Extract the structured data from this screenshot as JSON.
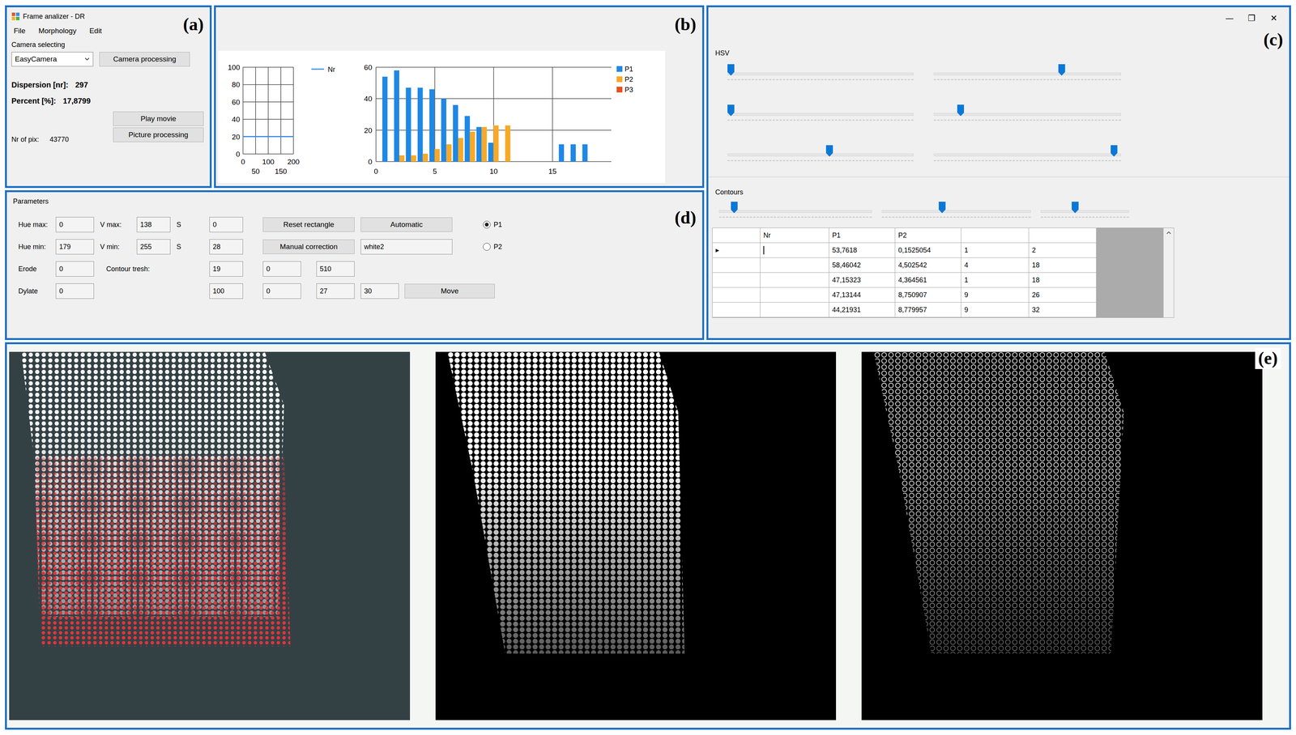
{
  "main_window": {
    "panel_label": "(a)",
    "title": "Frame analizer - DR",
    "menu": [
      "File",
      "Morphology",
      "Edit"
    ],
    "camera_group": "Camera selecting",
    "camera_dropdown": "EasyCamera",
    "camera_button": "Camera processing",
    "stats": [
      {
        "label": "Dispersion [nr]:",
        "value": "297"
      },
      {
        "label": "Percent [%]:",
        "value": "17,8799"
      }
    ],
    "pixels": {
      "label": "Nr of pix:",
      "value": "43770"
    },
    "buttons": [
      "Play movie",
      "Picture processing"
    ]
  },
  "charts": {
    "panel_label": "(b)",
    "line_chart": {
      "y_ticks": [
        "100",
        "80",
        "60",
        "40",
        "20",
        "0"
      ],
      "x_ticks": [
        "0",
        "100",
        "200"
      ],
      "x_ticks_minor": [
        "50",
        "150"
      ],
      "series": [
        {
          "name": "Nr",
          "color": "#3b8ee8",
          "x": [
            0,
            50,
            100,
            150,
            200
          ],
          "values": [
            20,
            20,
            20,
            20,
            20
          ]
        }
      ]
    },
    "bar_chart": {
      "y_ticks": [
        "60",
        "40",
        "20",
        "0"
      ],
      "x_ticks": [
        "0",
        "5",
        "10",
        "15"
      ],
      "series": [
        {
          "name": "P1",
          "color": "#1e88e5",
          "values": [
            54,
            58,
            47,
            47,
            46,
            40,
            36,
            29,
            22,
            12,
            0,
            0,
            0,
            0,
            0,
            11,
            11,
            11
          ]
        },
        {
          "name": "P2",
          "color": "#f7a928",
          "values": [
            0,
            4,
            4,
            5,
            8,
            11,
            15,
            19,
            22,
            23,
            23,
            0,
            0,
            0,
            0,
            0,
            0,
            0
          ]
        },
        {
          "name": "P3",
          "color": "#e8501c",
          "values": [
            0,
            0,
            0,
            0,
            0,
            0,
            0,
            0,
            0,
            0,
            0,
            0,
            0,
            0,
            0,
            0,
            0,
            0
          ]
        }
      ]
    }
  },
  "settings_window": {
    "panel_label": "(c)",
    "controls": [
      "—",
      "❐",
      "✕"
    ],
    "hsv": {
      "title": "HSV",
      "sliders": [
        {
          "level": 0.0
        },
        {
          "level": 0.69
        },
        {
          "level": 0.0
        },
        {
          "level": 0.13
        },
        {
          "level": 0.55
        },
        {
          "level": 0.98
        }
      ]
    },
    "contours": {
      "title": "Contours",
      "sliders": [
        {
          "level": 0.08
        },
        {
          "level": 0.4
        },
        {
          "level": 0.38
        }
      ]
    },
    "table": {
      "columns": [
        "",
        "Nr",
        "P1",
        "P2",
        "",
        ""
      ],
      "rows": [
        {
          "marker": "▶",
          "nr": "",
          "editing": true,
          "p1": "53,7618",
          "p2": "0,1525054",
          "c5": "1",
          "c6": "2"
        },
        {
          "marker": "",
          "nr": "",
          "editing": false,
          "p1": "58,46042",
          "p2": "4,502542",
          "c5": "4",
          "c6": "18"
        },
        {
          "marker": "",
          "nr": "",
          "editing": false,
          "p1": "47,15323",
          "p2": "4,364561",
          "c5": "1",
          "c6": "18"
        },
        {
          "marker": "",
          "nr": "",
          "editing": false,
          "p1": "47,13144",
          "p2": "8,750907",
          "c5": "9",
          "c6": "26"
        },
        {
          "marker": "",
          "nr": "",
          "editing": false,
          "p1": "44,21931",
          "p2": "8,779957",
          "c5": "9",
          "c6": "32"
        }
      ]
    }
  },
  "parameters": {
    "panel_label": "(d)",
    "title": "Parameters",
    "hue_max": {
      "label": "Hue max:",
      "value": "0"
    },
    "v_max": {
      "label": "V max:",
      "value": "138"
    },
    "s_max": {
      "label": "S",
      "value": "0"
    },
    "hue_min": {
      "label": "Hue min:",
      "value": "179"
    },
    "v_min": {
      "label": "V min:",
      "value": "255"
    },
    "s_min": {
      "label": "S",
      "value": "28"
    },
    "erode": {
      "label": "Erode",
      "value": "0"
    },
    "dylate": {
      "label": "Dylate",
      "value": "0"
    },
    "contour_thresh": {
      "label": "Contour tresh:",
      "value": "19"
    },
    "contour_extra": "100",
    "rect_fields": [
      "0",
      "510",
      "0",
      "27"
    ],
    "move_field": "30",
    "buttons": {
      "reset": "Reset rectangle",
      "automatic": "Automatic",
      "manual": "Manual correction",
      "move": "Move"
    },
    "name_field": "white2",
    "radios": [
      {
        "label": "P1",
        "selected": true
      },
      {
        "label": "P2",
        "selected": false
      }
    ]
  },
  "images": {
    "panel_label": "(e)"
  }
}
